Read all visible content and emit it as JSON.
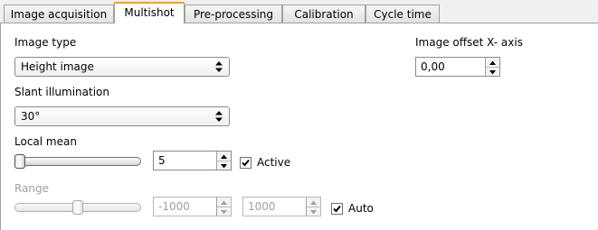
{
  "tabs": [
    {
      "label": "Image acquisition",
      "active": false
    },
    {
      "label": "Multishot",
      "active": true
    },
    {
      "label": "Pre-processing",
      "active": false
    },
    {
      "label": "Calibration",
      "active": false
    },
    {
      "label": "Cycle time",
      "active": false
    }
  ],
  "image_type": {
    "label": "Image type",
    "value": "Height image"
  },
  "slant_illumination": {
    "label": "Slant illumination",
    "value": "30°"
  },
  "local_mean": {
    "label": "Local mean",
    "value": "5",
    "slider_level": 0.0,
    "active_checkbox": {
      "label": "Active",
      "checked": true
    }
  },
  "range": {
    "label": "Range",
    "min_value": "-1000",
    "max_value": "1000",
    "slider_level": 0.5,
    "enabled": false,
    "auto_checkbox": {
      "label": "Auto",
      "checked": true
    }
  },
  "image_offset_x": {
    "label": "Image offset X- axis",
    "value": "0,00"
  }
}
